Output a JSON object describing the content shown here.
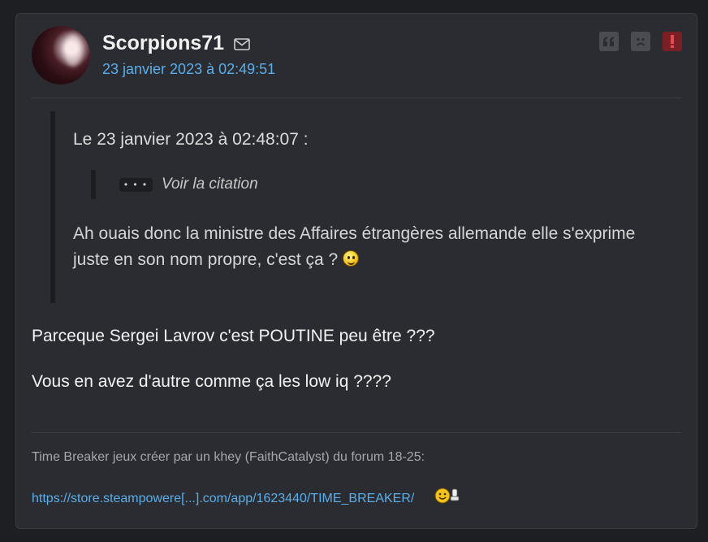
{
  "post": {
    "author": "Scorpions71",
    "date": "23 janvier 2023 à 02:49:51",
    "actions": [
      "quote-icon",
      "sad-face-icon",
      "report-icon"
    ],
    "quote": {
      "header": "Le 23 janvier 2023 à 02:48:07 :",
      "nested_button": "• • •",
      "nested_label": "Voir la citation",
      "text": "Ah ouais donc la ministre des Affaires étrangères allemande elle s'exprime juste en son nom propre, c'est ça ?"
    },
    "body": [
      "Parceque Sergei Lavrov c'est POUTINE peu être ???",
      "Vous en avez d'autre comme ça les low iq ????"
    ],
    "signature": {
      "text": "Time Breaker jeux créer par un khey (FaithCatalyst) du forum 18-25:",
      "link": "https://store.steampowere[...].com/app/1623440/TIME_BREAKER/"
    }
  },
  "colors": {
    "background": "#1e1f23",
    "card": "#2a2c31",
    "link": "#5aaeea",
    "report": "#7a1f24"
  }
}
